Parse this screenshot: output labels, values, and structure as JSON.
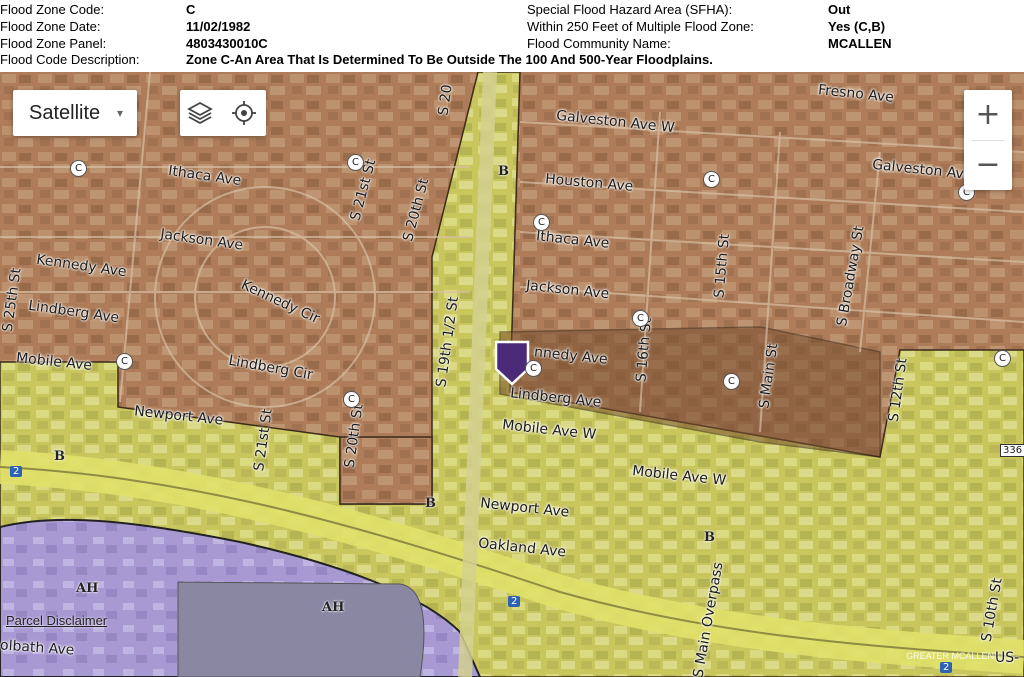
{
  "info": {
    "flood_zone_code_label": "Flood Zone Code:",
    "flood_zone_code_value": "C",
    "flood_zone_date_label": "Flood Zone Date:",
    "flood_zone_date_value": "11/02/1982",
    "flood_zone_panel_label": "Flood Zone Panel:",
    "flood_zone_panel_value": "4803430010C",
    "flood_code_description_label": "Flood Code Description:",
    "flood_code_description_value": "Zone C-An Area That Is Determined To Be Outside The 100 And 500-Year Floodplains.",
    "sfha_label": "Special Flood Hazard Area (SFHA):",
    "sfha_value": "Out",
    "within_250_label": "Within 250 Feet of Multiple Flood Zone:",
    "within_250_value": "Yes (C,B)",
    "community_label": "Flood Community Name:",
    "community_value": "MCALLEN"
  },
  "controls": {
    "map_type": "Satellite",
    "map_type_caret": "▾",
    "zoom_in": "+",
    "zoom_out": "−",
    "layers_icon": "layers-icon",
    "locate_icon": "locate-icon"
  },
  "map": {
    "streets": {
      "fresno": "Fresno Ave",
      "galveston_w": "Galveston Ave W",
      "galveston": "Galveston Ave",
      "houston": "Houston Ave",
      "ithaca_left": "Ithaca Ave",
      "ithaca_right": "Ithaca Ave",
      "jackson_left": "Jackson Ave",
      "jackson_right": "Jackson Ave",
      "kennedy_left": "Kennedy Ave",
      "kennedy_cir": "Kennedy Cir",
      "kennedy_right": "nnedy Ave",
      "lindberg_left": "Lindberg Ave",
      "lindberg_cir": "Lindberg Cir",
      "lindberg_right": "Lindberg Ave",
      "mobile_left": "Mobile Ave",
      "mobile_w": "Mobile Ave W",
      "mobile_w2": "Mobile Ave W",
      "newport_left": "Newport Ave",
      "newport_right": "Newport Ave",
      "oakland": "Oakland Ave",
      "olbath": "olbath Ave",
      "s25th": "S 25th St",
      "s21st_upper": "S 21st St",
      "s20th_upper": "S 20th St",
      "s20_top": "S 20",
      "s19half": "S 19th 1/2 St",
      "s21st_lower": "S 21st St",
      "s20th_lower": "S 20th St",
      "s16th": "S 16th St",
      "s15th": "S 15th St",
      "sbroadway": "S Broadway St",
      "smain": "S Main St",
      "s12th": "S 12th St",
      "smainoverpass": "S Main Overpass",
      "s10th": "S 10th St",
      "us": "US-",
      "hwy_2a": "2",
      "hwy_2b": "2",
      "hwy_2c": "2",
      "hwy_336": "336"
    },
    "zone_badges": [
      "C",
      "C",
      "C",
      "C",
      "C",
      "C",
      "C",
      "C",
      "C",
      "C",
      "C"
    ],
    "zone_letters": {
      "b1": "B",
      "b2": "B",
      "b3": "B",
      "b4": "B",
      "ah1": "AH",
      "ah2": "AH"
    },
    "disclaimer": "Parcel Disclaimer",
    "watermark": "GREATER MCALLEN",
    "colors": {
      "zone_c_fill": "#b9825a",
      "zone_b_fill": "#d9d96a",
      "zone_ah_fill": "#a99bd8",
      "marker": "#4b2a78"
    }
  }
}
